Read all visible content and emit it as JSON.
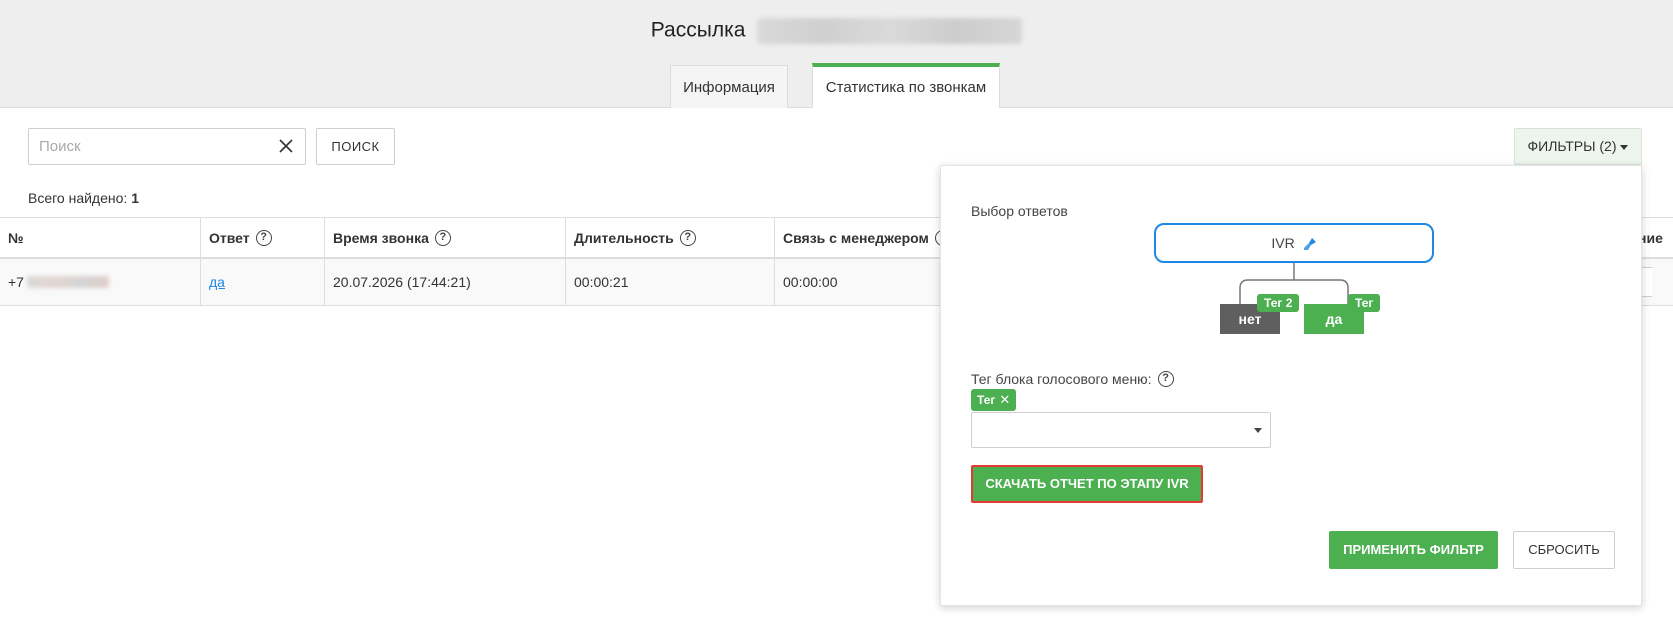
{
  "header": {
    "title": "Рассылка",
    "tabs": [
      {
        "label": "Информация"
      },
      {
        "label": "Статистика по звонкам"
      }
    ]
  },
  "toolbar": {
    "search_placeholder": "Поиск",
    "search_value": "",
    "search_button": "ПОИСК",
    "filters_button": "ФИЛЬТРЫ (2)"
  },
  "summary": {
    "label": "Всего найдено:",
    "count": "1"
  },
  "table": {
    "columns": [
      "№",
      "Ответ",
      "Время звонка",
      "Длительность",
      "Связь с менеджером",
      "ние"
    ],
    "rows": [
      {
        "number_prefix": "+7",
        "answer": "да",
        "call_time": "20.07.2026 (17:44:21)",
        "duration": "00:00:21",
        "manager_link": "00:00:00"
      }
    ]
  },
  "filter_panel": {
    "title": "Выбор ответов",
    "ivr_label": "IVR",
    "node_no": "нет",
    "node_yes": "да",
    "tag_no": "Тег 2",
    "tag_yes": "Тег",
    "tag_field_label": "Тег блока голосового меню:",
    "selected_tag": "Тег",
    "download_button": "СКАЧАТЬ ОТЧЕТ ПО ЭТАПУ IVR",
    "apply_button": "ПРИМЕНИТЬ ФИЛЬТР",
    "reset_button": "СБРОСИТЬ"
  },
  "colors": {
    "accent_green": "#4caf50",
    "ivr_border_blue": "#1e88e5",
    "highlight_red": "#e53935"
  }
}
